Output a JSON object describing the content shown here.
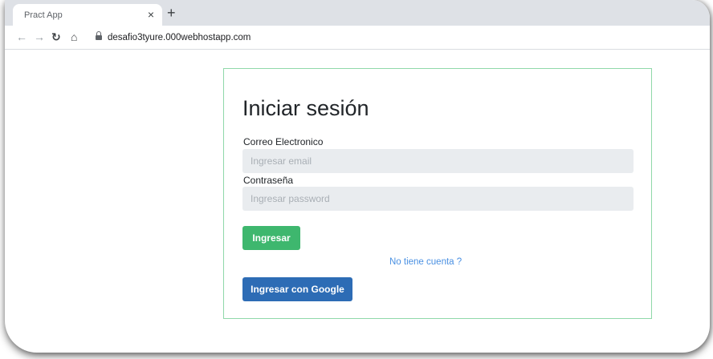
{
  "browser": {
    "tab_title": "Pract App",
    "tab_close": "×",
    "new_tab": "+",
    "url": "desafio3tyure.000webhostapp.com"
  },
  "icons": {
    "back": "back-arrow-icon",
    "forward": "forward-arrow-icon",
    "reload": "reload-icon",
    "home": "home-icon",
    "lock": "lock-icon"
  },
  "login": {
    "title": "Iniciar sesión",
    "email_label": "Correo Electronico",
    "email_placeholder": "Ingresar email",
    "email_value": "",
    "password_label": "Contraseña",
    "password_placeholder": "Ingresar password",
    "password_value": "",
    "submit_label": "Ingresar",
    "no_account_link": "No tiene cuenta ?",
    "google_label": "Ingresar con Google"
  },
  "colors": {
    "card_border": "#8fd8a9",
    "submit_bg": "#3eb76e",
    "google_bg": "#2d6cb5",
    "link": "#4a90e2",
    "input_bg": "#e9ecef"
  }
}
